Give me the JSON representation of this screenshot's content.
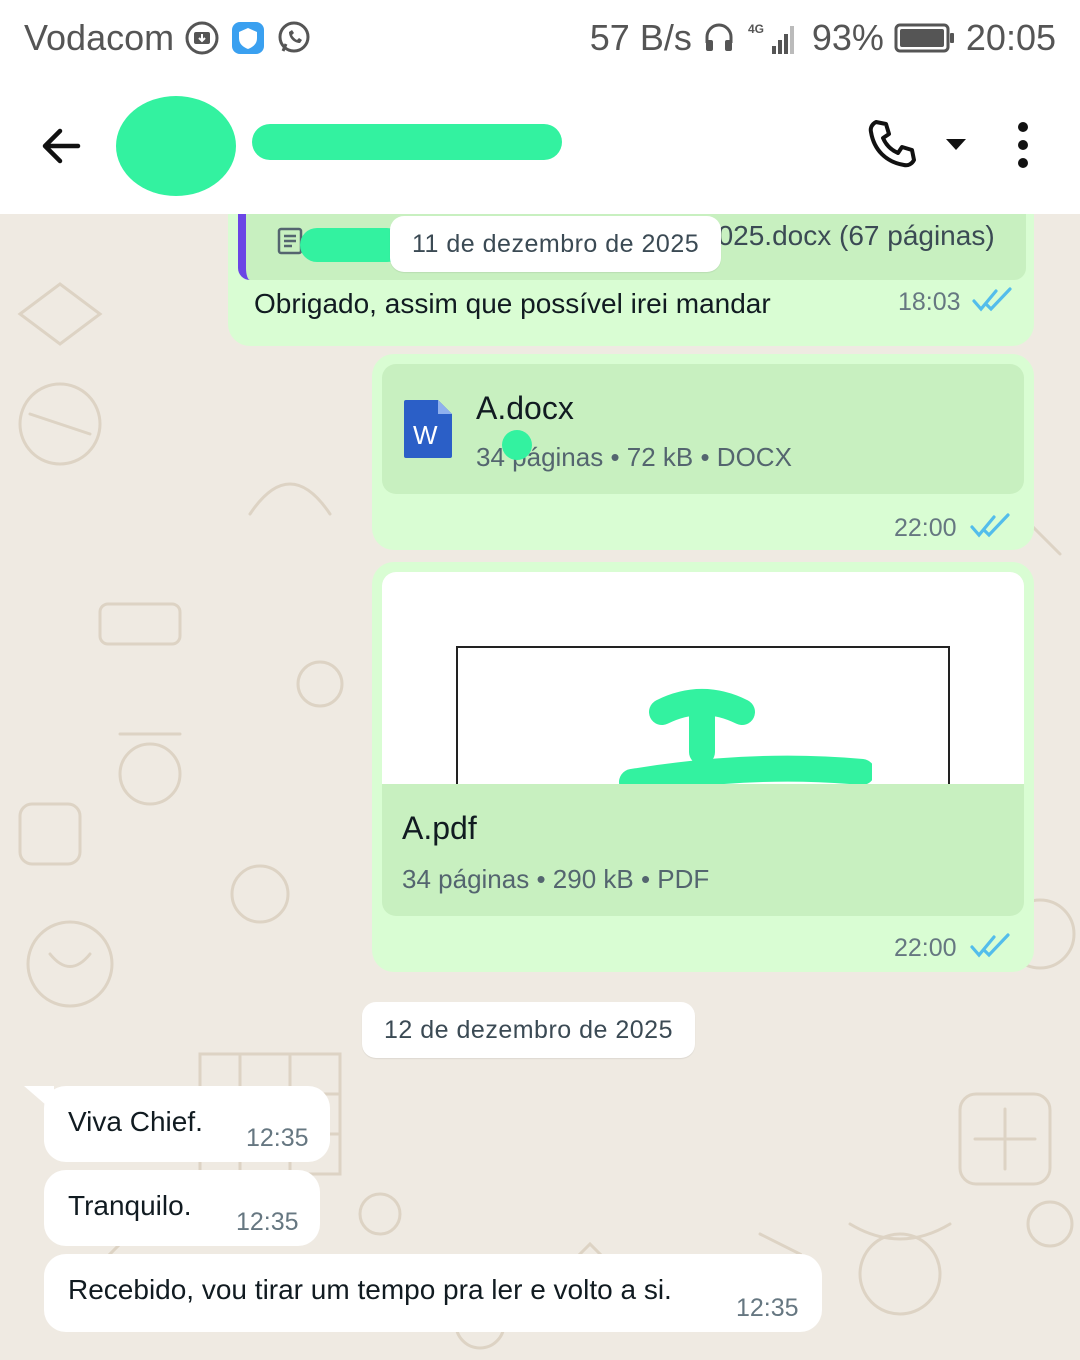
{
  "status_bar": {
    "carrier": "Vodacom",
    "network_speed": "57 B/s",
    "network_type": "4G",
    "battery": "93%",
    "time": "20:05"
  },
  "header": {
    "contact_name": "",
    "icons": [
      "back-arrow-icon",
      "voice-call-icon",
      "caret-down-icon",
      "more-options-icon"
    ]
  },
  "messages": {
    "quoted_file": "2025.docx (67 páginas)",
    "date_chip_top": "11 de dezembro de 2025",
    "reply_text": "Obrigado, assim que possível irei mandar",
    "reply_time": "18:03",
    "docx": {
      "name": "A.docx",
      "meta": "34 páginas • 72 kB • DOCX",
      "time": "22:00"
    },
    "pdf": {
      "name": "A.pdf",
      "meta": "34 páginas • 290 kB • PDF",
      "time": "22:00"
    },
    "date_chip": "12 de dezembro de 2025",
    "incoming": [
      {
        "text": "Viva Chief.",
        "time": "12:35"
      },
      {
        "text": "Tranquilo.",
        "time": "12:35"
      },
      {
        "text": "Recebido, vou tirar um tempo pra ler e volto a si.",
        "time": "12:35"
      }
    ]
  },
  "colors": {
    "outgoing_bubble": "#d9fdd3",
    "incoming_bubble": "#ffffff",
    "chat_background": "#efeae2",
    "read_ticks": "#53bdeb",
    "redaction": "#33f2a0",
    "word_blue": "#2b5fc7"
  }
}
